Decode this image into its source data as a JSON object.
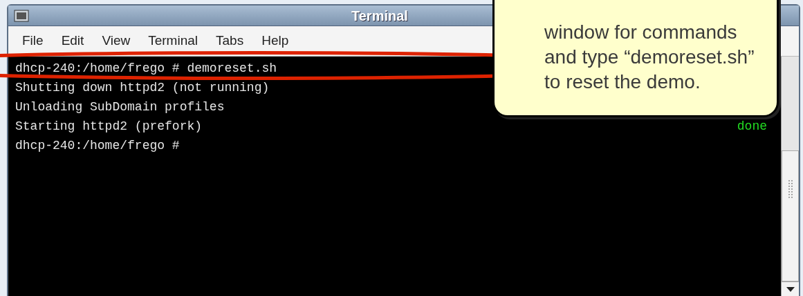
{
  "window": {
    "title": "Terminal"
  },
  "menu": [
    "File",
    "Edit",
    "View",
    "Terminal",
    "Tabs",
    "Help"
  ],
  "terminal": {
    "lines": [
      {
        "text": "dhcp-240:/home/frego # demoreset.sh"
      },
      {
        "text": "Shutting down httpd2 (not running)"
      },
      {
        "text": "Unloading SubDomain profiles"
      },
      {
        "text": "Starting httpd2 (prefork)",
        "status": "done"
      },
      {
        "text": "dhcp-240:/home/frego #"
      }
    ]
  },
  "callout": {
    "text": "window for commands and type “demoreset.sh” to reset the demo."
  }
}
